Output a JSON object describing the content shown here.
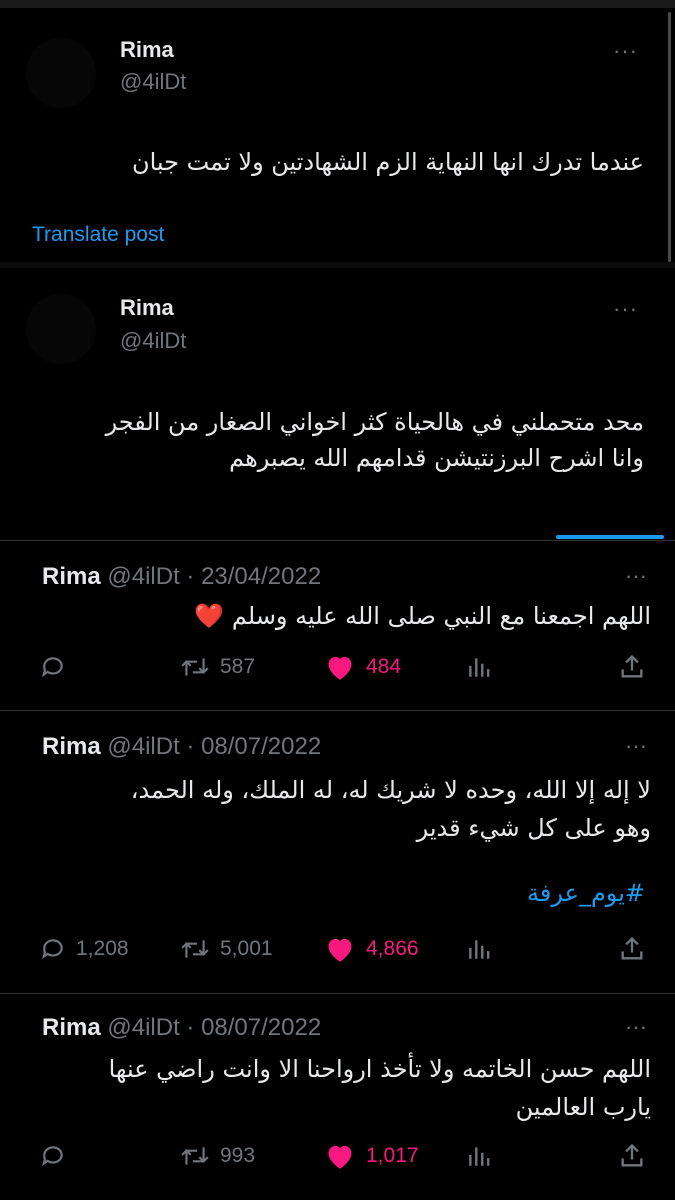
{
  "posts": [
    {
      "name": "Rima",
      "handle": "@4ilDt",
      "more": "···",
      "body": "عندما تدرك انها النهاية الزم الشهادتين ولا تمت جبان",
      "translate": "Translate post"
    },
    {
      "name": "Rima",
      "handle": "@4ilDt",
      "more": "···",
      "body_line1": "محد متحملني في هالحياة كثر اخواني الصغار من الفجر",
      "body_line2": "وانا اشرح البرزنتيشن قدامهم الله يصبرهم"
    }
  ],
  "tweets": [
    {
      "name": "Rima",
      "meta": "@4ilDt · 23/04/2022",
      "more": "···",
      "body": "اللهم اجمعنا مع النبي صلى الله عليه وسلم ❤️",
      "replies": "",
      "retweets": "587",
      "likes": "484"
    },
    {
      "name": "Rima",
      "meta": "@4ilDt · 08/07/2022",
      "more": "···",
      "body_line1": "لا إله إلا الله، وحده لا شريك له، له الملك، وله الحمد،",
      "body_line2": "وهو على كل شيء قدير",
      "hashtag": "#يوم_عرفة",
      "replies": "1,208",
      "retweets": "5,001",
      "likes": "4,866"
    },
    {
      "name": "Rima",
      "meta": "@4ilDt · 08/07/2022",
      "more": "···",
      "body_line1": "اللهم حسن الخاتمه ولا تأخذ ارواحنا الا وانت راضي عنها",
      "body_line2": "يارب العالمين",
      "replies": "",
      "retweets": "993",
      "likes": "1,017"
    }
  ],
  "icons": {
    "reply": "reply-icon",
    "retweet": "retweet-icon",
    "like": "heart-icon",
    "views": "views-icon",
    "share": "share-icon"
  },
  "colors": {
    "accent": "#1d9bf0",
    "like": "#f91880",
    "muted": "#71767b"
  }
}
